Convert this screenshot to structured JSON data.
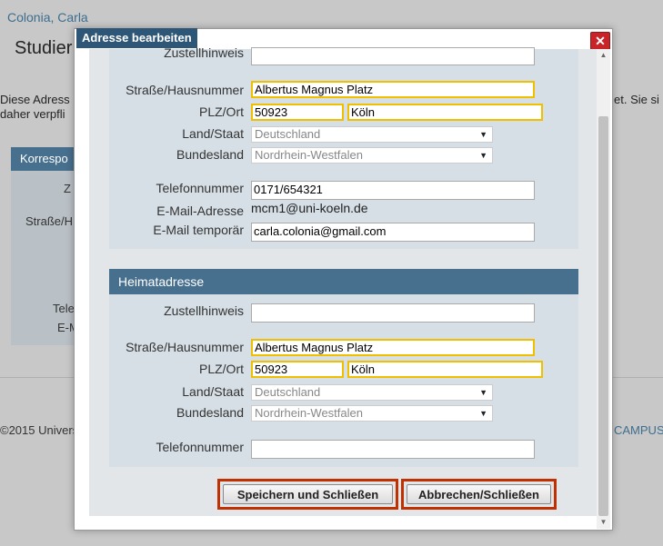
{
  "background": {
    "user_name": "Colonia, Carla",
    "page_title": "Studier",
    "text_line1": "Diese Adress",
    "text_line2": "daher verpfli",
    "text_right": "et. Sie si",
    "box_header": "Korrespo",
    "box_labels": [
      "Z",
      "Straße/H",
      "Tele",
      "E-M"
    ],
    "footer_left": "©2015 Univers",
    "footer_right": "CAMPUS"
  },
  "dialog": {
    "title": "Adresse bearbeiten",
    "close_symbol": "✕",
    "korrespondenz": {
      "zustellhinweis_label": "Zustellhinweis",
      "zustellhinweis_value": "",
      "strasse_label": "Straße/Hausnummer",
      "strasse_value": "Albertus Magnus Platz",
      "plzort_label": "PLZ/Ort",
      "plz_value": "50923",
      "ort_value": "Köln",
      "land_label": "Land/Staat",
      "land_value": "Deutschland",
      "bundesland_label": "Bundesland",
      "bundesland_value": "Nordrhein-Westfalen",
      "telefon_label": "Telefonnummer",
      "telefon_value": "0171/654321",
      "email_label": "E-Mail-Adresse",
      "email_value": "mcm1@uni-koeln.de",
      "email_temp_label": "E-Mail temporär",
      "email_temp_value": "carla.colonia@gmail.com"
    },
    "heimat": {
      "header": "Heimatadresse",
      "zustellhinweis_label": "Zustellhinweis",
      "zustellhinweis_value": "",
      "strasse_label": "Straße/Hausnummer",
      "strasse_value": "Albertus Magnus Platz",
      "plzort_label": "PLZ/Ort",
      "plz_value": "50923",
      "ort_value": "Köln",
      "land_label": "Land/Staat",
      "land_value": "Deutschland",
      "bundesland_label": "Bundesland",
      "bundesland_value": "Nordrhein-Westfalen",
      "telefon_label": "Telefonnummer",
      "telefon_value": ""
    },
    "buttons": {
      "save": "Speichern und Schließen",
      "cancel": "Abbrechen/Schließen"
    },
    "colors": {
      "header_bg": "#476f8e",
      "title_bg": "#2e5676",
      "required_border": "#f0c000",
      "button_highlight": "#c03000",
      "close_bg": "#c9232a"
    }
  }
}
